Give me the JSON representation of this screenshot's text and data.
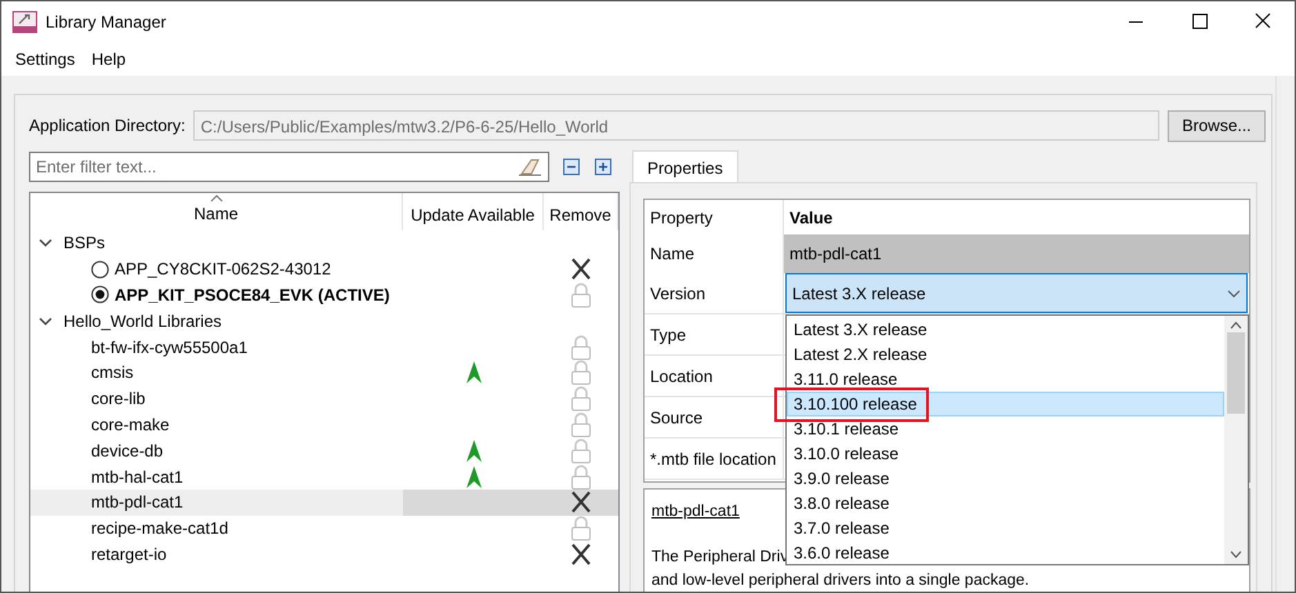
{
  "window": {
    "title": "Library Manager"
  },
  "menu": [
    "Settings",
    "Help"
  ],
  "app_directory": {
    "label": "Application Directory:",
    "value": "C:/Users/Public/Examples/mtw3.2/P6-6-25/Hello_World",
    "button": "Browse..."
  },
  "filter": {
    "placeholder": "Enter filter text..."
  },
  "tree": {
    "columns": [
      "Name",
      "Update Available",
      "Remove"
    ],
    "groups": [
      {
        "label": "BSPs",
        "expanded": true,
        "kind": "radio",
        "items": [
          {
            "name": "APP_CY8CKIT-062S2-43012",
            "selected": false,
            "update": false,
            "removable": true
          },
          {
            "name": "APP_KIT_PSOCE84_EVK (ACTIVE)",
            "selected": true,
            "update": false,
            "removable": false
          }
        ]
      },
      {
        "label": "Hello_World Libraries",
        "expanded": true,
        "kind": "plain",
        "items": [
          {
            "name": "bt-fw-ifx-cyw55500a1",
            "selected": false,
            "update": false,
            "removable": false
          },
          {
            "name": "cmsis",
            "selected": false,
            "update": true,
            "removable": false
          },
          {
            "name": "core-lib",
            "selected": false,
            "update": false,
            "removable": false
          },
          {
            "name": "core-make",
            "selected": false,
            "update": false,
            "removable": false
          },
          {
            "name": "device-db",
            "selected": false,
            "update": true,
            "removable": false
          },
          {
            "name": "mtb-hal-cat1",
            "selected": false,
            "update": true,
            "removable": false
          },
          {
            "name": "mtb-pdl-cat1",
            "selected": true,
            "update": false,
            "removable": true
          },
          {
            "name": "recipe-make-cat1d",
            "selected": false,
            "update": false,
            "removable": false
          },
          {
            "name": "retarget-io",
            "selected": false,
            "update": false,
            "removable": true
          }
        ]
      }
    ]
  },
  "tabs": [
    {
      "label": "Properties",
      "selected": true
    }
  ],
  "properties": {
    "columns": [
      "Property",
      "Value"
    ],
    "rows": [
      {
        "property": "Name",
        "value": "mtb-pdl-cat1"
      },
      {
        "property": "Version",
        "value": "Latest 3.X release"
      },
      {
        "property": "Type"
      },
      {
        "property": "Location"
      },
      {
        "property": "Source"
      },
      {
        "property": "*.mtb file location"
      }
    ]
  },
  "version_dropdown": {
    "items": [
      {
        "label": "Latest 3.X release",
        "selected": false,
        "highlighted": false
      },
      {
        "label": "Latest 2.X release",
        "selected": false,
        "highlighted": false
      },
      {
        "label": "3.11.0 release",
        "selected": false,
        "highlighted": false
      },
      {
        "label": "3.10.100 release",
        "selected": true,
        "highlighted": true
      },
      {
        "label": "3.10.1 release",
        "selected": false,
        "highlighted": false
      },
      {
        "label": "3.10.0 release",
        "selected": false,
        "highlighted": false
      },
      {
        "label": "3.9.0 release",
        "selected": false,
        "highlighted": false
      },
      {
        "label": "3.8.0 release",
        "selected": false,
        "highlighted": false
      },
      {
        "label": "3.7.0 release",
        "selected": false,
        "highlighted": false
      },
      {
        "label": "3.6.0 release",
        "selected": false,
        "highlighted": false
      }
    ]
  },
  "description": {
    "link": "mtb-pdl-cat1",
    "lines": [
      "The Peripheral Driv",
      "and low-level peripheral drivers into a single package."
    ]
  }
}
